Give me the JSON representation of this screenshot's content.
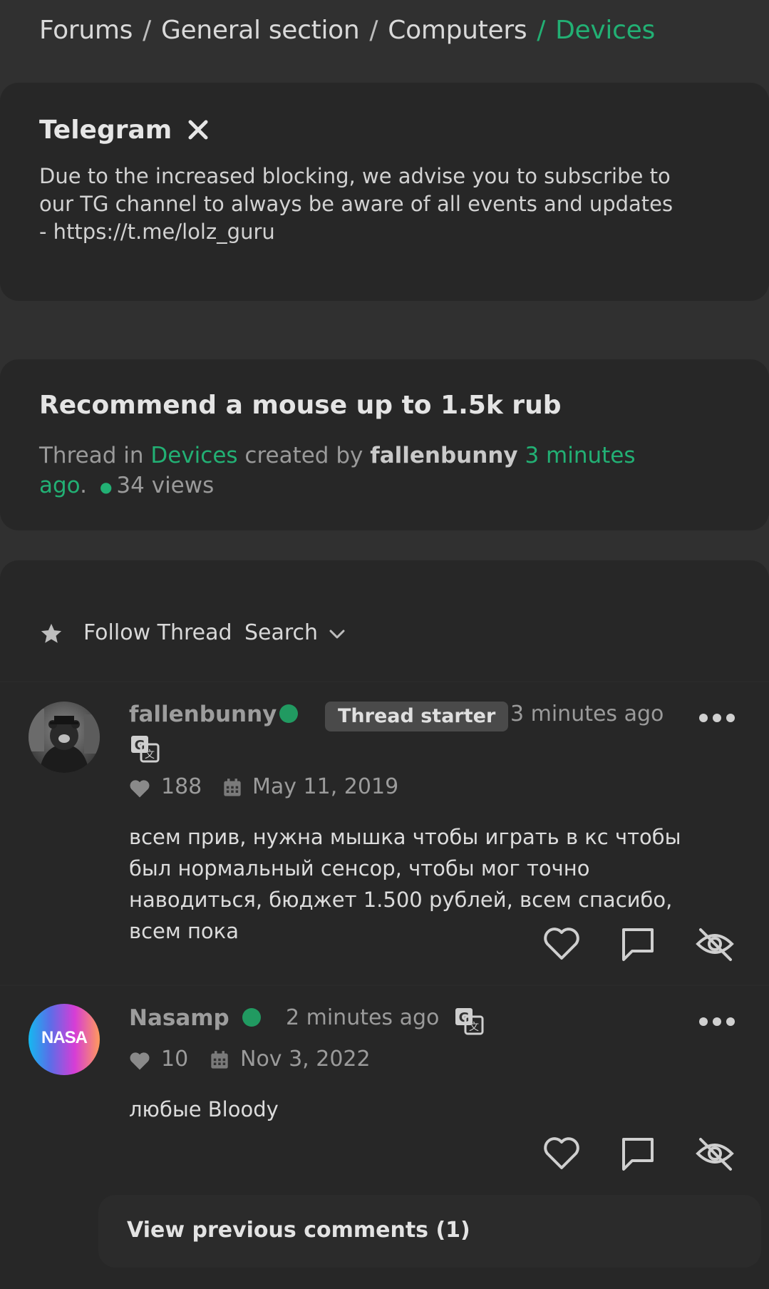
{
  "breadcrumb": {
    "items": [
      "Forums",
      "General section",
      "Computers"
    ],
    "separator": "/",
    "active": "Devices"
  },
  "notice": {
    "title": "Telegram",
    "text": "Due to the increased blocking, we advise you to subscribe to our TG channel to always be aware of all events and updates - https://t.me/lolz_guru"
  },
  "thread": {
    "title": "Recommend a mouse up to 1.5k rub",
    "meta_prefix": "Thread in",
    "forum": "Devices",
    "created_by": "created by",
    "author": "fallenbunny",
    "time": "3 minutes ago",
    "period": ".",
    "views": "34 views"
  },
  "toolbar": {
    "follow": "Follow Thread",
    "search": "Search"
  },
  "posts": [
    {
      "username": "fallenbunny",
      "badge": "Thread starter",
      "time": "3 minutes ago",
      "likes": "188",
      "joined": "May 11, 2019",
      "text": "всем прив, нужна мышка чтобы играть в кс чтобы был нормальный сенсор, чтобы мог точно наводиться, бюджет 1.500 рублей, всем спасибо, всем пока"
    },
    {
      "username": "Nasamp",
      "avatar_text": "NASA",
      "time": "2 minutes ago",
      "likes": "10",
      "joined": "Nov 3, 2022",
      "text": "любые Bloody"
    }
  ],
  "view_previous": "View previous comments (1)",
  "colors": {
    "background": "#303030",
    "card": "#272727",
    "accent": "#22b074",
    "online": "#219a61"
  }
}
